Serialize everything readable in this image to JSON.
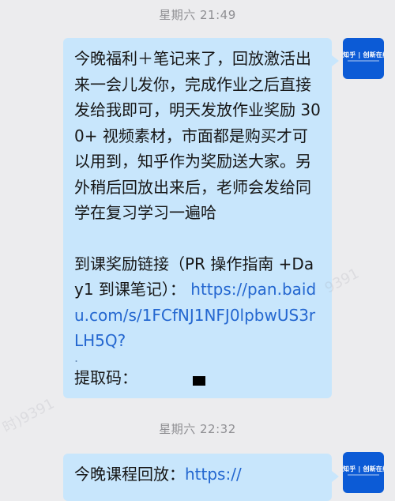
{
  "timestamps": [
    "星期六 21:49",
    "星期六 22:32"
  ],
  "messages": [
    {
      "paragraph": "今晚福利＋笔记来了，回放激活出来一会儿发你，完成作业之后直接发给我即可，明天发放作业奖励 300+ 视频素材，市面都是购买才可以用到，知乎作为奖励送大家。另外稍后回放出来后，老师会发给同学在复习学习一遍哈",
      "link_intro": "到课奖励链接（PR 操作指南 +Day1 到课笔记）：",
      "link": "https://pan.baidu.com/s/1FCfNJ1NFJ0lpbwUS3rLH5Q?",
      "dot": ".",
      "code_label": "提取码："
    },
    {
      "intro": "今晚课程回放：",
      "link": "https://"
    }
  ],
  "avatar": {
    "logo": "知乎 | 创新在线"
  },
  "watermarks": [
    "9391",
    "时)9391"
  ],
  "colors": {
    "background": "#ececee",
    "bubble": "#c8e6fc",
    "link": "#2467d0",
    "avatar": "#0c5bd6"
  }
}
